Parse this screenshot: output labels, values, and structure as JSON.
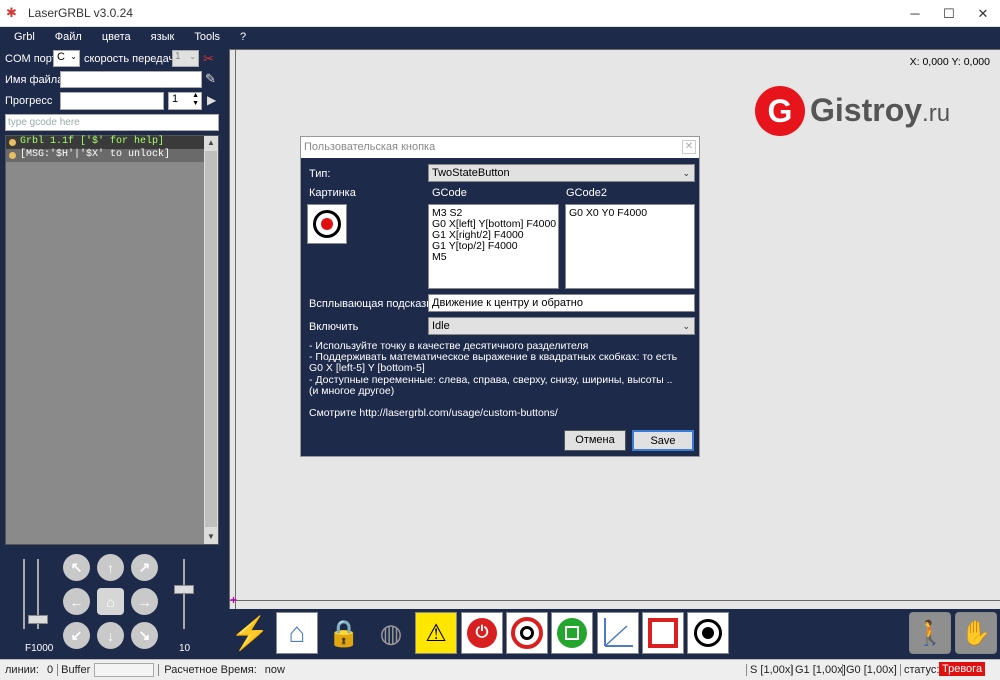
{
  "window": {
    "title": "LaserGRBL v3.0.24",
    "controls": [
      "minimize-icon",
      "maximize-icon",
      "close-icon"
    ]
  },
  "menu": [
    "Grbl",
    "Файл",
    "цвета",
    "язык",
    "Tools",
    "?"
  ],
  "left": {
    "com_label": "COM порт",
    "com_value": "C",
    "speed_label": "скорость передачи",
    "speed_value": "1",
    "file_label": "Имя файла",
    "file_value": "",
    "progress_label": "Прогресс",
    "progress_count": "1",
    "gcode_placeholder": "type gcode here",
    "console_lines": [
      "Grbl 1.1f ['$' for help]",
      "[MSG:'$H'|'$X' to unlock]"
    ],
    "feed_label": "F1000",
    "step_label": "10"
  },
  "canvas": {
    "coords": "X: 0,000 Y: 0,000",
    "brand_text": "Gistroy",
    "brand_suffix": ".ru",
    "brand_color": "#e8141c"
  },
  "dialog": {
    "title": "Пользовательская кнопка",
    "type_label": "Тип:",
    "type_value": "TwoStateButton",
    "image_label": "Картинка",
    "gcode_label": "GCode",
    "gcode2_label": "GCode2",
    "gcode_value": "M3 S2\nG0 X[left] Y[bottom] F4000\nG1 X[right/2] F4000\nG1 Y[top/2] F4000\nM5",
    "gcode2_value": "G0 X0 Y0 F4000",
    "tooltip_label": "Всплывающая подсказка",
    "tooltip_value": "Движение к центру и обратно",
    "enable_label": "Включить",
    "enable_value": "Idle",
    "notes": [
      "- Используйте точку в качестве десятичного разделителя",
      "- Поддерживать математическое выражение в квадратных скобках: то есть",
      "G0 X [left-5] Y [bottom-5]",
      "- Доступные переменные: слева, справа, сверху, снизу, ширины, высоты ..",
      "(и многое другое)"
    ],
    "link": "Смотрите http://lasergrbl.com/usage/custom-buttons/",
    "cancel_label": "Отмена",
    "save_label": "Save"
  },
  "toolbar": [
    "lightning-icon",
    "home-icon",
    "lock-icon",
    "globe-icon",
    "laser-warning-icon",
    "power-icon",
    "target-icon",
    "frame-icon",
    "axes-icon",
    "resize-icon",
    "record-icon"
  ],
  "status": {
    "lines_label": "линии:",
    "lines_value": "0",
    "buffer_label": "Buffer",
    "time_label": "Расчетное Время:",
    "time_value": "now",
    "s_value": "S [1,00x]",
    "g1_value": "G1 [1,00x]",
    "g0_value": "G0 [1,00x]",
    "status_label": "статус:",
    "status_value": "Тревога",
    "alarm_color": "#e01010"
  }
}
